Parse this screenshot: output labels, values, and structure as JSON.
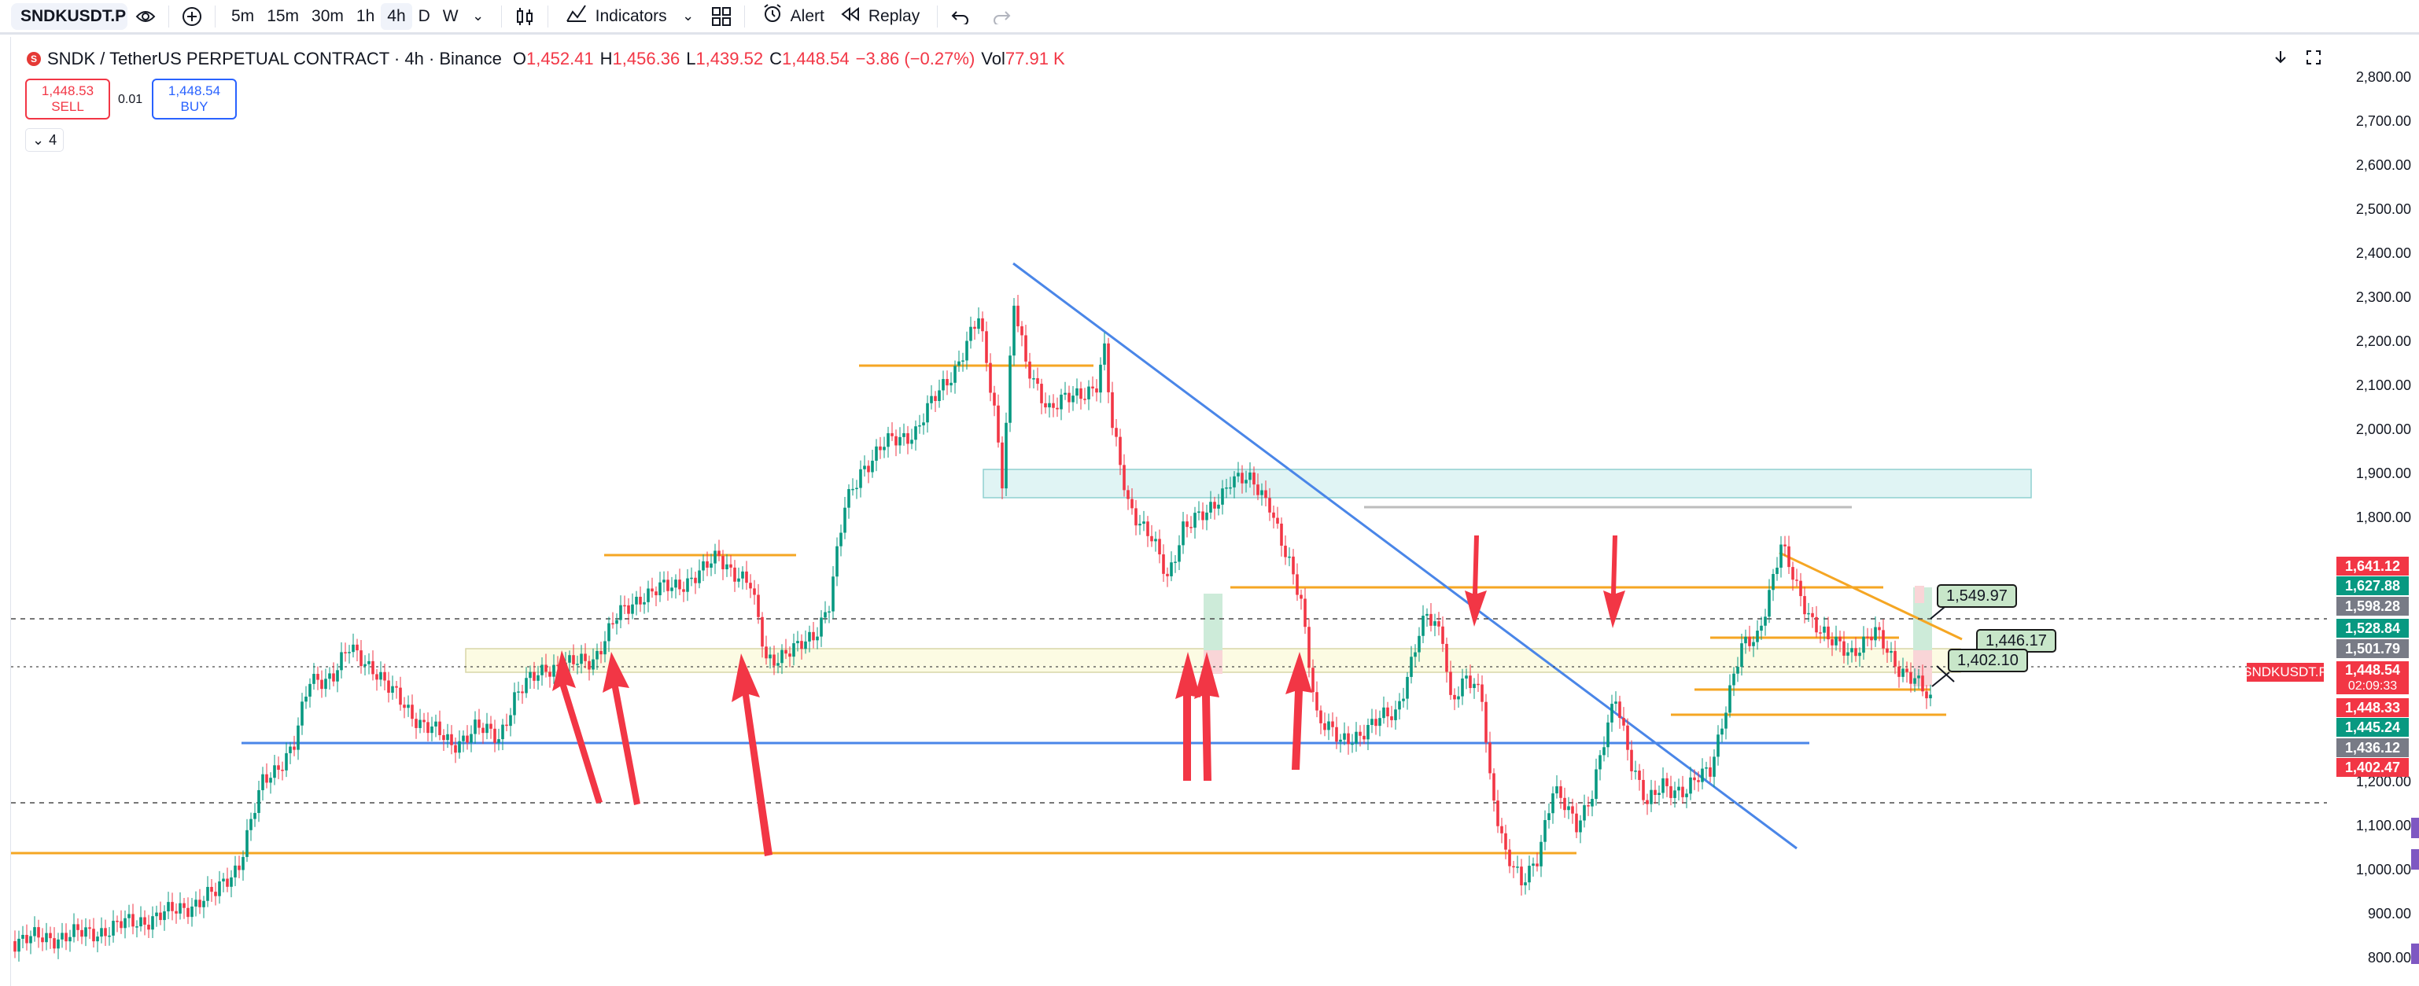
{
  "toolbar": {
    "symbol": "SNDKUSDT.P",
    "intervals": [
      {
        "label": "5m",
        "active": false
      },
      {
        "label": "15m",
        "active": false
      },
      {
        "label": "30m",
        "active": false
      },
      {
        "label": "1h",
        "active": false
      },
      {
        "label": "4h",
        "active": true
      },
      {
        "label": "D",
        "active": false
      },
      {
        "label": "W",
        "active": false
      }
    ],
    "indicators_label": "Indicators",
    "alert_label": "Alert",
    "replay_label": "Replay"
  },
  "legend": {
    "title": "SNDK / TetherUS PERPETUAL CONTRACT · 4h · Binance",
    "o_key": "O",
    "o_val": "1,452.41",
    "h_key": "H",
    "h_val": "1,456.36",
    "l_key": "L",
    "l_val": "1,439.52",
    "c_key": "C",
    "c_val": "1,448.54",
    "change": "−3.86 (−0.27%)",
    "vol_key": "Vol",
    "vol_val": "77.91 K"
  },
  "trade": {
    "sell_price": "1,448.53",
    "sell_label": "SELL",
    "buy_price": "1,448.54",
    "buy_label": "BUY",
    "spread": "0.01"
  },
  "indicator_toggle": {
    "count": "4"
  },
  "price_scale": {
    "ticks": [
      "2,800.00",
      "2,700.00",
      "2,600.00",
      "2,500.00",
      "2,400.00",
      "2,300.00",
      "2,200.00",
      "2,100.00",
      "2,000.00",
      "1,900.00",
      "1,800.00",
      "1,200.00",
      "1,100.00",
      "1,000.00",
      "900.00",
      "800.00"
    ],
    "tags": [
      {
        "value": "1,641.12",
        "color": "#f23645"
      },
      {
        "value": "1,627.88",
        "color": "#089981"
      },
      {
        "value": "1,598.28",
        "color": "#787b86"
      },
      {
        "value": "1,528.84",
        "color": "#089981"
      },
      {
        "value": "1,501.79",
        "color": "#787b86"
      },
      {
        "value": "1,448.54",
        "color": "#f23645"
      },
      {
        "value": "02:09:33",
        "color": "#f23645"
      },
      {
        "value": "1,448.33",
        "color": "#f23645"
      },
      {
        "value": "1,445.24",
        "color": "#089981"
      },
      {
        "value": "1,436.12",
        "color": "#787b86"
      },
      {
        "value": "1,402.47",
        "color": "#f23645"
      }
    ],
    "symbol_tag": "SNDKUSDT.P"
  },
  "callouts": [
    "1,549.97",
    "1,446.17",
    "1,402.10"
  ],
  "colors": {
    "up": "#089981",
    "down": "#f23645",
    "orange_level": "#f5a623",
    "trend_blue": "#4a86e8",
    "arrow_red": "#f23645"
  }
}
